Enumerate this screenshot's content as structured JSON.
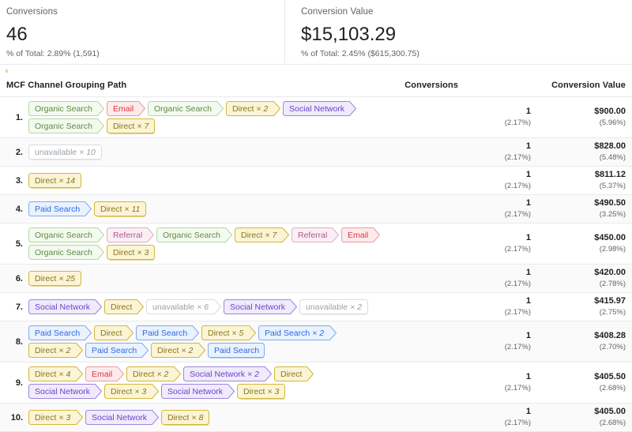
{
  "summary": {
    "conversions": {
      "label": "Conversions",
      "value": "46",
      "sub": "% of Total: 2.89% (1,591)"
    },
    "conversion_value": {
      "label": "Conversion Value",
      "value": "$15,103.29",
      "sub": "% of Total: 2.45% ($615,300.75)"
    }
  },
  "table": {
    "headers": {
      "path": "MCF Channel Grouping Path",
      "conversions": "Conversions",
      "conversion_value": "Conversion Value"
    },
    "channel_colors": {
      "Organic Search": "#5f8a46",
      "Email": "#e0323f",
      "Direct": "#8a7520",
      "Social Network": "#6a43c9",
      "Paid Search": "#2d6ae0",
      "Referral": "#b0578c",
      "unavailable": "#9aa0a6"
    },
    "rows": [
      {
        "rank": "1.",
        "conversions": "1",
        "conversions_pct": "(2.17%)",
        "value": "$900.00",
        "value_pct": "(5.96%)",
        "lines": [
          [
            {
              "label": "Organic Search",
              "mult": "",
              "channel": "organic",
              "terminal": false
            },
            {
              "label": "Email",
              "mult": "",
              "channel": "email",
              "terminal": false
            },
            {
              "label": "Organic Search",
              "mult": "",
              "channel": "organic",
              "terminal": false
            },
            {
              "label": "Direct",
              "mult": "× 2",
              "channel": "direct",
              "terminal": false
            },
            {
              "label": "Social Network",
              "mult": "",
              "channel": "social",
              "terminal": false
            }
          ],
          [
            {
              "label": "Organic Search",
              "mult": "",
              "channel": "organic",
              "terminal": false
            },
            {
              "label": "Direct",
              "mult": "× 7",
              "channel": "direct",
              "terminal": true
            }
          ]
        ]
      },
      {
        "rank": "2.",
        "conversions": "1",
        "conversions_pct": "(2.17%)",
        "value": "$828.00",
        "value_pct": "(5.48%)",
        "lines": [
          [
            {
              "label": "unavailable",
              "mult": "× 10",
              "channel": "unavail",
              "terminal": true
            }
          ]
        ]
      },
      {
        "rank": "3.",
        "conversions": "1",
        "conversions_pct": "(2.17%)",
        "value": "$811.12",
        "value_pct": "(5.37%)",
        "lines": [
          [
            {
              "label": "Direct",
              "mult": "× 14",
              "channel": "direct",
              "terminal": true
            }
          ]
        ]
      },
      {
        "rank": "4.",
        "conversions": "1",
        "conversions_pct": "(2.17%)",
        "value": "$490.50",
        "value_pct": "(3.25%)",
        "lines": [
          [
            {
              "label": "Paid Search",
              "mult": "",
              "channel": "paid",
              "terminal": false
            },
            {
              "label": "Direct",
              "mult": "× 11",
              "channel": "direct",
              "terminal": true
            }
          ]
        ]
      },
      {
        "rank": "5.",
        "conversions": "1",
        "conversions_pct": "(2.17%)",
        "value": "$450.00",
        "value_pct": "(2.98%)",
        "lines": [
          [
            {
              "label": "Organic Search",
              "mult": "",
              "channel": "organic",
              "terminal": false
            },
            {
              "label": "Referral",
              "mult": "",
              "channel": "referral",
              "terminal": false
            },
            {
              "label": "Organic Search",
              "mult": "",
              "channel": "organic",
              "terminal": false
            },
            {
              "label": "Direct",
              "mult": "× 7",
              "channel": "direct",
              "terminal": false
            },
            {
              "label": "Referral",
              "mult": "",
              "channel": "referral",
              "terminal": false
            },
            {
              "label": "Email",
              "mult": "",
              "channel": "email",
              "terminal": false
            }
          ],
          [
            {
              "label": "Organic Search",
              "mult": "",
              "channel": "organic",
              "terminal": false
            },
            {
              "label": "Direct",
              "mult": "× 3",
              "channel": "direct",
              "terminal": true
            }
          ]
        ]
      },
      {
        "rank": "6.",
        "conversions": "1",
        "conversions_pct": "(2.17%)",
        "value": "$420.00",
        "value_pct": "(2.78%)",
        "lines": [
          [
            {
              "label": "Direct",
              "mult": "× 25",
              "channel": "direct",
              "terminal": true
            }
          ]
        ]
      },
      {
        "rank": "7.",
        "conversions": "1",
        "conversions_pct": "(2.17%)",
        "value": "$415.97",
        "value_pct": "(2.75%)",
        "lines": [
          [
            {
              "label": "Social Network",
              "mult": "",
              "channel": "social",
              "terminal": false
            },
            {
              "label": "Direct",
              "mult": "",
              "channel": "direct",
              "terminal": false
            },
            {
              "label": "unavailable",
              "mult": "× 6",
              "channel": "unavail",
              "terminal": false
            },
            {
              "label": "Social Network",
              "mult": "",
              "channel": "social",
              "terminal": false
            },
            {
              "label": "unavailable",
              "mult": "× 2",
              "channel": "unavail",
              "terminal": true
            }
          ]
        ]
      },
      {
        "rank": "8.",
        "conversions": "1",
        "conversions_pct": "(2.17%)",
        "value": "$408.28",
        "value_pct": "(2.70%)",
        "lines": [
          [
            {
              "label": "Paid Search",
              "mult": "",
              "channel": "paid",
              "terminal": false
            },
            {
              "label": "Direct",
              "mult": "",
              "channel": "direct",
              "terminal": false
            },
            {
              "label": "Paid Search",
              "mult": "",
              "channel": "paid",
              "terminal": false
            },
            {
              "label": "Direct",
              "mult": "× 5",
              "channel": "direct",
              "terminal": false
            },
            {
              "label": "Paid Search",
              "mult": "× 2",
              "channel": "paid",
              "terminal": false
            }
          ],
          [
            {
              "label": "Direct",
              "mult": "× 2",
              "channel": "direct",
              "terminal": false
            },
            {
              "label": "Paid Search",
              "mult": "",
              "channel": "paid",
              "terminal": false
            },
            {
              "label": "Direct",
              "mult": "× 2",
              "channel": "direct",
              "terminal": false
            },
            {
              "label": "Paid Search",
              "mult": "",
              "channel": "paid",
              "terminal": true
            }
          ]
        ]
      },
      {
        "rank": "9.",
        "conversions": "1",
        "conversions_pct": "(2.17%)",
        "value": "$405.50",
        "value_pct": "(2.68%)",
        "lines": [
          [
            {
              "label": "Direct",
              "mult": "× 4",
              "channel": "direct",
              "terminal": false
            },
            {
              "label": "Email",
              "mult": "",
              "channel": "email",
              "terminal": false
            },
            {
              "label": "Direct",
              "mult": "× 2",
              "channel": "direct",
              "terminal": false
            },
            {
              "label": "Social Network",
              "mult": "× 2",
              "channel": "social",
              "terminal": false
            },
            {
              "label": "Direct",
              "mult": "",
              "channel": "direct",
              "terminal": false
            }
          ],
          [
            {
              "label": "Social Network",
              "mult": "",
              "channel": "social",
              "terminal": false
            },
            {
              "label": "Direct",
              "mult": "× 3",
              "channel": "direct",
              "terminal": false
            },
            {
              "label": "Social Network",
              "mult": "",
              "channel": "social",
              "terminal": false
            },
            {
              "label": "Direct",
              "mult": "× 3",
              "channel": "direct",
              "terminal": true
            }
          ]
        ]
      },
      {
        "rank": "10.",
        "conversions": "1",
        "conversions_pct": "(2.17%)",
        "value": "$405.00",
        "value_pct": "(2.68%)",
        "lines": [
          [
            {
              "label": "Direct",
              "mult": "× 3",
              "channel": "direct",
              "terminal": false
            },
            {
              "label": "Social Network",
              "mult": "",
              "channel": "social",
              "terminal": false
            },
            {
              "label": "Direct",
              "mult": "× 8",
              "channel": "direct",
              "terminal": true
            }
          ]
        ]
      }
    ]
  }
}
